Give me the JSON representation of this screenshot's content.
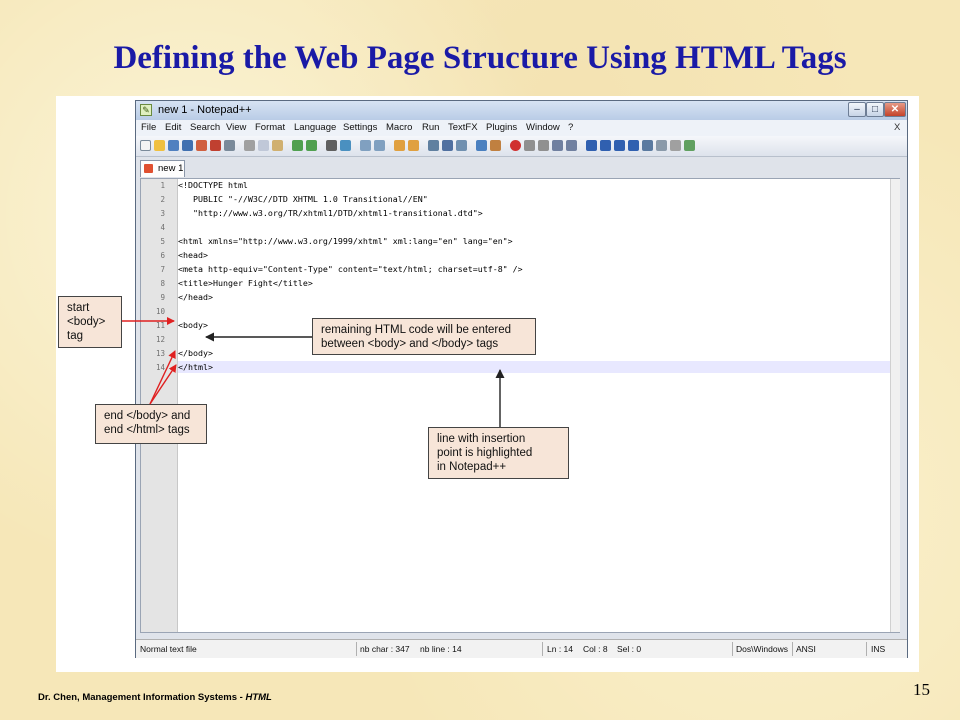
{
  "slide": {
    "title": "Defining the Web Page Structure Using HTML Tags",
    "footer_author": "Dr. Chen, Management Information Systems - ",
    "footer_topic": "HTML",
    "page_number": "15"
  },
  "window": {
    "title": "new  1 - Notepad++",
    "minimize_glyph": "–",
    "maximize_glyph": "□",
    "close_glyph": "✕"
  },
  "menu": {
    "items": [
      "File",
      "Edit",
      "Search",
      "View",
      "Format",
      "Language",
      "Settings",
      "Macro",
      "Run",
      "TextFX",
      "Plugins",
      "Window",
      "?"
    ],
    "close_glyph": "X"
  },
  "tab": {
    "label": "new  1"
  },
  "editor": {
    "line_numbers": [
      "1",
      "2",
      "3",
      "4",
      "5",
      "6",
      "7",
      "8",
      "9",
      "10",
      "11",
      "12",
      "13",
      "14"
    ],
    "lines": [
      "<!DOCTYPE html",
      "   PUBLIC \"-//W3C//DTD XHTML 1.0 Transitional//EN\"",
      "   \"http://www.w3.org/TR/xhtml1/DTD/xhtml1-transitional.dtd\">",
      "",
      "<html xmlns=\"http://www.w3.org/1999/xhtml\" xml:lang=\"en\" lang=\"en\">",
      "<head>",
      "<meta http-equiv=\"Content-Type\" content=\"text/html; charset=utf-8\" />",
      "<title>Hunger Fight</title>",
      "</head>",
      "",
      "<body>",
      "",
      "</body>",
      "</html>"
    ]
  },
  "statusbar": {
    "file_type": "Normal text file",
    "nb_char": "nb char : 347",
    "nb_line": "nb line : 14",
    "ln": "Ln : 14",
    "col": "Col : 8",
    "sel": "Sel : 0",
    "eol": "Dos\\Windows",
    "encoding": "ANSI",
    "mode": "INS"
  },
  "callouts": {
    "start_body": [
      "start",
      "<body>",
      "tag"
    ],
    "end_tags": [
      "end </body> and",
      "end </html> tags"
    ],
    "remaining_code": [
      "remaining HTML code will be entered",
      "between <body> and </body> tags"
    ],
    "insertion_point": [
      "line with insertion",
      "point is highlighted",
      "in Notepad++"
    ]
  },
  "colors": {
    "title": "#1a1aa6",
    "callout_fill": "#f7e5d8",
    "callout_arrow_red": "#e02020",
    "callout_arrow_dark": "#222222",
    "line_highlight": "#e8e8ff"
  }
}
